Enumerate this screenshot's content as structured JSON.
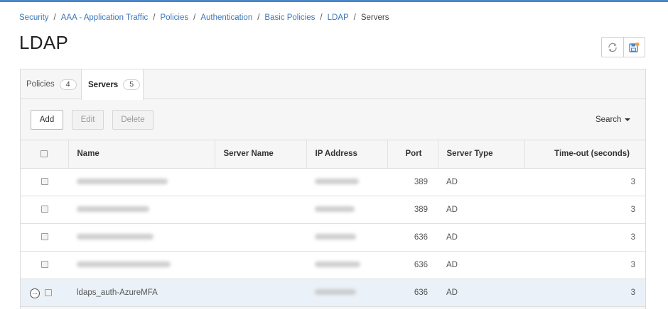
{
  "breadcrumb": {
    "items": [
      "Security",
      "AAA - Application Traffic",
      "Policies",
      "Authentication",
      "Basic Policies",
      "LDAP"
    ],
    "current": "Servers",
    "separator": "/"
  },
  "page": {
    "title": "LDAP"
  },
  "toolbar_icons": {
    "refresh": "refresh-icon",
    "save": "save-icon"
  },
  "tabs": [
    {
      "label": "Policies",
      "count": "4",
      "active": false
    },
    {
      "label": "Servers",
      "count": "5",
      "active": true
    }
  ],
  "actions": {
    "add": "Add",
    "edit": "Edit",
    "delete": "Delete",
    "search": "Search"
  },
  "table": {
    "columns": [
      "Name",
      "Server Name",
      "IP Address",
      "Port",
      "Server Type",
      "Time-out (seconds)"
    ],
    "rows": [
      {
        "name": "",
        "server_name": "",
        "ip": "",
        "port": "389",
        "type": "AD",
        "timeout": "3",
        "redacted": true
      },
      {
        "name": "",
        "server_name": "",
        "ip": "",
        "port": "389",
        "type": "AD",
        "timeout": "3",
        "redacted": true
      },
      {
        "name": "",
        "server_name": "",
        "ip": "",
        "port": "636",
        "type": "AD",
        "timeout": "3",
        "redacted": true
      },
      {
        "name": "",
        "server_name": "",
        "ip": "",
        "port": "636",
        "type": "AD",
        "timeout": "3",
        "redacted": true
      },
      {
        "name": "ldaps_auth-AzureMFA",
        "server_name": "",
        "ip": "",
        "port": "636",
        "type": "AD",
        "timeout": "3",
        "redacted": false
      }
    ]
  },
  "colors": {
    "accent": "#3b77b8",
    "top_bar": "#4a86c8",
    "selected_row": "#eaf1f8"
  }
}
